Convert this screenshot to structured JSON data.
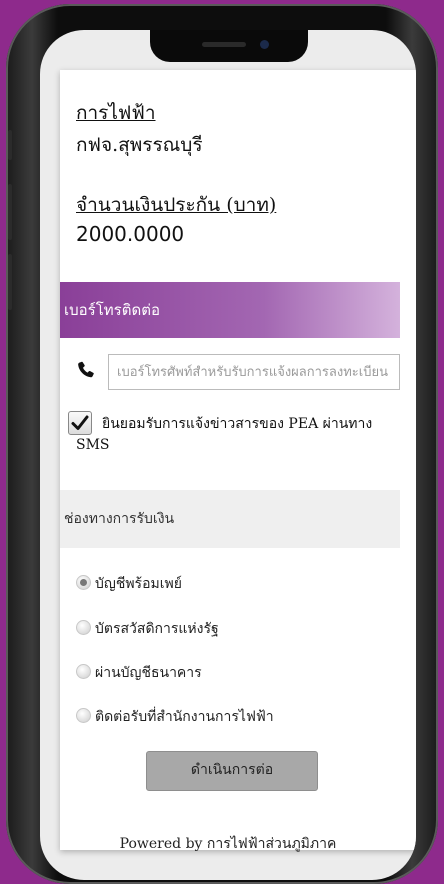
{
  "electricity": {
    "label": "การไฟฟ้า",
    "value": "กฟจ.สุพรรณบุรี"
  },
  "deposit": {
    "label": "จำนวนเงินประกัน (บาท)",
    "value": "2000.0000"
  },
  "contact": {
    "section_title": "เบอร์โทรติดต่อ",
    "phone_placeholder": "เบอร์โทรศัพท์สำหรับรับการแจ้งผลการลงทะเบียน",
    "phone_icon": "phone-icon",
    "consent_label": "ยินยอมรับการแจ้งข่าวสารของ PEA ผ่านทาง SMS",
    "consent_checked": true
  },
  "payment": {
    "section_title": "ช่องทางการรับเงิน",
    "options": [
      {
        "label": "บัญชีพร้อมเพย์",
        "selected": true
      },
      {
        "label": "บัตรสวัสดิการแห่งรัฐ",
        "selected": false
      },
      {
        "label": "ผ่านบัญชีธนาคาร",
        "selected": false
      },
      {
        "label": "ติดต่อรับที่สำนักงานการไฟฟ้า",
        "selected": false
      }
    ]
  },
  "actions": {
    "continue_label": "ดำเนินการต่อ"
  },
  "footer": {
    "text": "Powered by การไฟฟ้าส่วนภูมิภาค"
  },
  "colors": {
    "background": "#8e2a8c",
    "section_gradient_start": "#8a3f98",
    "section_gradient_end": "#d4b2dc",
    "button_gray": "#a8a8a8"
  }
}
